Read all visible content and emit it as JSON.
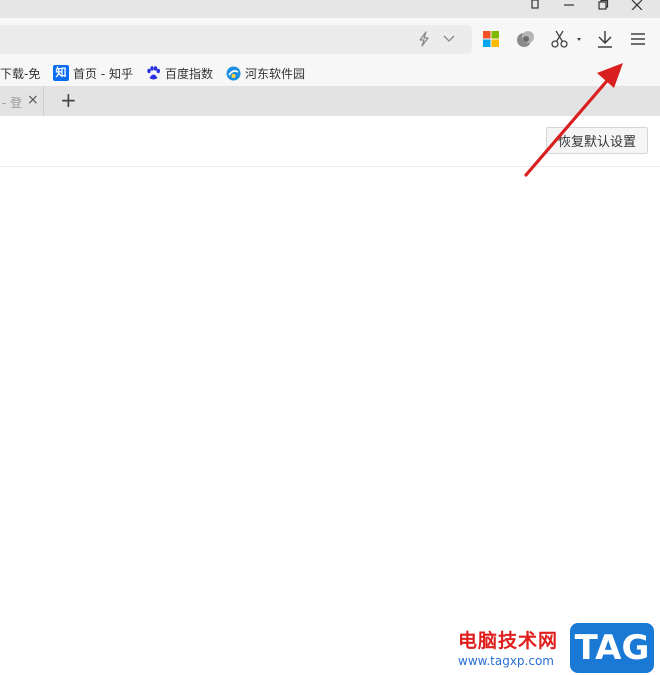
{
  "window": {
    "icons": [
      "pin-icon",
      "minimize-icon",
      "restore-icon",
      "close-icon"
    ]
  },
  "toolbar": {
    "icons": [
      "lightning-icon",
      "chevron-down-icon",
      "apps-grid-icon",
      "extension-icon",
      "scissors-icon",
      "download-icon",
      "menu-icon"
    ]
  },
  "bookmarks": {
    "items": [
      {
        "label": "下载-免"
      },
      {
        "label": "首页 - 知乎",
        "icon_text": "知"
      },
      {
        "label": "百度指数"
      },
      {
        "label": "河东软件园"
      }
    ]
  },
  "tabs": {
    "items": [
      {
        "label": "- 登"
      }
    ],
    "close_glyph": "×",
    "new_tab_glyph": "+"
  },
  "settings": {
    "restore_defaults_label": "恢复默认设置"
  },
  "watermark": {
    "site_name": "电脑技术网",
    "url": "www.tagxp.com",
    "badge": "TAG"
  },
  "colors": {
    "arrow": "#d9201f",
    "zhihu_blue": "#0a6cf0",
    "baidu_blue": "#2932e1",
    "watermark_red": "#e0201f",
    "watermark_blue": "#1a79d4"
  }
}
